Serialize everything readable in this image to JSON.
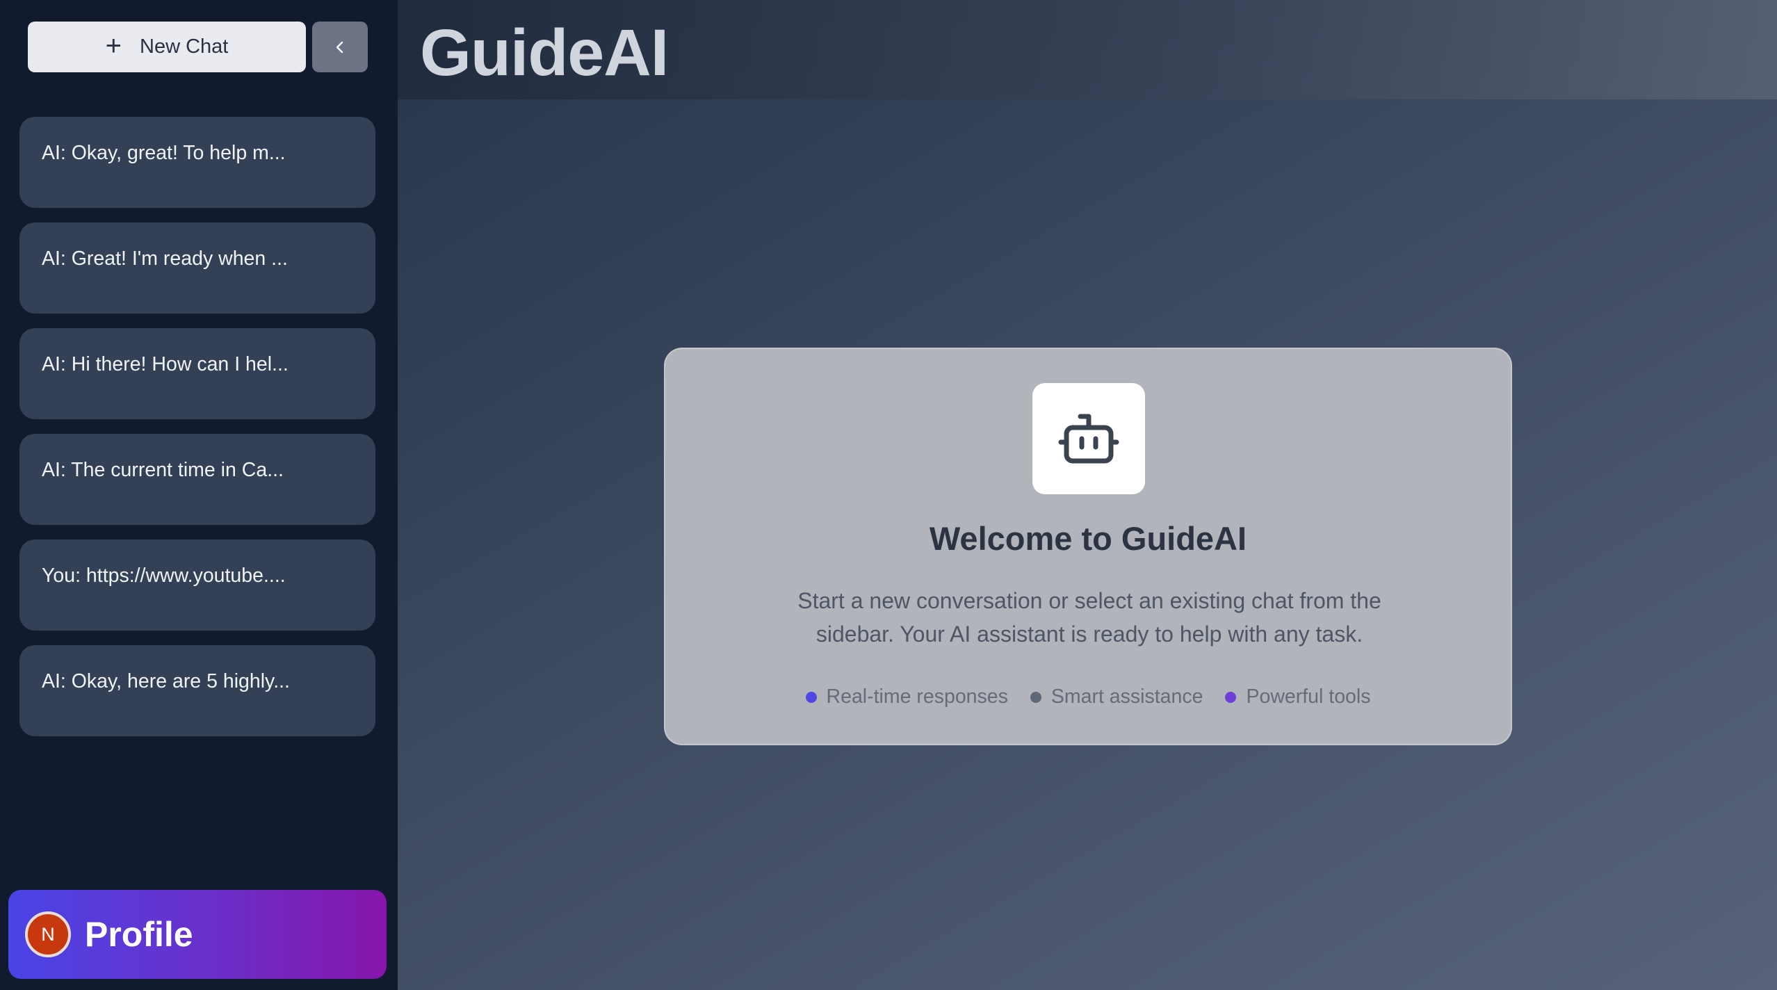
{
  "sidebar": {
    "new_chat_label": "New Chat",
    "chats": [
      {
        "label": "AI: Okay, great! To help m..."
      },
      {
        "label": "AI: Great! I'm ready when ..."
      },
      {
        "label": "AI: Hi there! How can I hel..."
      },
      {
        "label": "AI: The current time in Ca..."
      },
      {
        "label": "You: https://www.youtube...."
      },
      {
        "label": "AI: Okay, here are 5 highly..."
      }
    ],
    "profile": {
      "initial": "N",
      "label": "Profile"
    }
  },
  "header": {
    "title": "GuideAI"
  },
  "welcome": {
    "icon": "bot-icon",
    "title": "Welcome to GuideAI",
    "text": "Start a new conversation or select an existing chat from the sidebar. Your AI assistant is ready to help with any task.",
    "features": [
      {
        "label": "Real-time responses",
        "color": "#4f46e5"
      },
      {
        "label": "Smart assistance",
        "color": "#5f6675"
      },
      {
        "label": "Powerful tools",
        "color": "#6d3fd8"
      }
    ]
  },
  "colors": {
    "sidebar_bg": "#121a2e",
    "chat_item_bg": "#334055",
    "profile_gradient_start": "#4a44e6",
    "profile_gradient_end": "#8615a9",
    "avatar_bg": "#c8380f"
  }
}
